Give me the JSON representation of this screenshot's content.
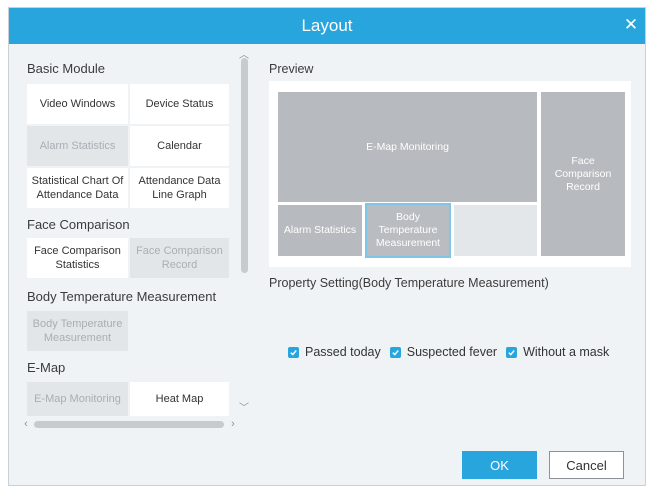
{
  "dialog": {
    "title": "Layout",
    "close_icon": "close-icon"
  },
  "left": {
    "sections": {
      "basic": "Basic Module",
      "face": "Face Comparison",
      "body_temp": "Body Temperature Measurement",
      "emap": "E-Map"
    },
    "tiles": {
      "video_windows": "Video Windows",
      "device_status": "Device Status",
      "alarm_statistics": "Alarm Statistics",
      "calendar": "Calendar",
      "stat_chart_l1": "Statistical Chart Of",
      "stat_chart_l2": "Attendance Data",
      "att_line_l1": "Attendance Data",
      "att_line_l2": "Line Graph",
      "face_stats_l1": "Face Comparison",
      "face_stats_l2": "Statistics",
      "face_record_l1": "Face Comparison",
      "face_record_l2": "Record",
      "body_temp_l1": "Body Temperature",
      "body_temp_l2": "Measurement",
      "emap_monitoring": "E-Map Monitoring",
      "heat_map": "Heat Map"
    },
    "disabled_tiles": [
      "Alarm Statistics",
      "Face Comparison Record",
      "Body Temperature Measurement",
      "E-Map Monitoring"
    ]
  },
  "preview": {
    "label": "Preview",
    "emap_monitoring": "E-Map Monitoring",
    "face_record_l1": "Face",
    "face_record_l2": "Comparison",
    "face_record_l3": "Record",
    "alarm_statistics": "Alarm Statistics",
    "body_temp_l1": "Body",
    "body_temp_l2": "Temperature",
    "body_temp_l3": "Measurement"
  },
  "property": {
    "label": "Property Setting(Body Temperature Measurement)",
    "options": [
      {
        "label": "Passed today",
        "checked": true
      },
      {
        "label": "Suspected fever",
        "checked": true
      },
      {
        "label": "Without a mask",
        "checked": true
      }
    ]
  },
  "buttons": {
    "ok": "OK",
    "cancel": "Cancel"
  },
  "colors": {
    "accent": "#27a5dc",
    "panel_bg": "#f0f3f6",
    "tile_disabled": "#e3e6e9",
    "preview_block": "#b7babe"
  }
}
